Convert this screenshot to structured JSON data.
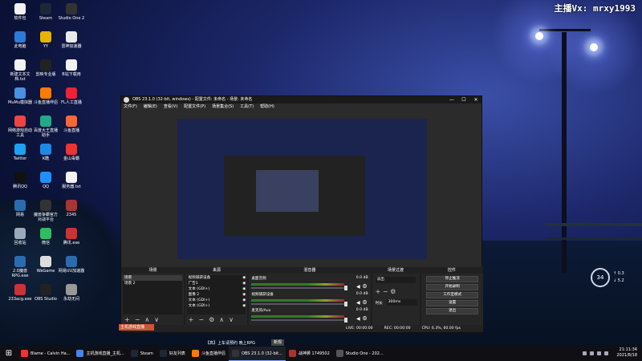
{
  "streamer_watermark": "主播Vx: mrxy1993",
  "desktop_icons": [
    {
      "label": "软件包",
      "color": "#f2f2f2"
    },
    {
      "label": "Steam",
      "color": "#1b2838"
    },
    {
      "label": "Studio One 2",
      "color": "#333"
    },
    {
      "label": "此电脑",
      "color": "#2e7bd6"
    },
    {
      "label": "YY",
      "color": "#e6b400"
    },
    {
      "label": "雷神加速器",
      "color": "#eaeaea"
    },
    {
      "label": "新建文本文档.txt",
      "color": "#f2f2f2"
    },
    {
      "label": "剪映专业版",
      "color": "#222"
    },
    {
      "label": "B站下载用",
      "color": "#f2f2f2"
    },
    {
      "label": "MuMu模拟器",
      "color": "#4a90e2"
    },
    {
      "label": "斗鱼直播伴侣",
      "color": "#ff7a00"
    },
    {
      "label": "FL人工直播",
      "color": "#e23"
    },
    {
      "label": "网络游戏自动工具",
      "color": "#e44"
    },
    {
      "label": "百度大王直播助手",
      "color": "#2a8"
    },
    {
      "label": "斗鱼直播",
      "color": "#f63"
    },
    {
      "label": "Twitter",
      "color": "#1da1f2"
    },
    {
      "label": "K酷",
      "color": "#1e88e5"
    },
    {
      "label": "金山毒霸",
      "color": "#e33"
    },
    {
      "label": "腾讯QQ",
      "color": "#111"
    },
    {
      "label": "QQ",
      "color": "#1e90ff"
    },
    {
      "label": "服务器.txt",
      "color": "#f2f2f2"
    },
    {
      "label": "网易",
      "color": "#2b6cb0"
    },
    {
      "label": "魔兽争霸官方对战平台",
      "color": "#333"
    },
    {
      "label": "2345",
      "color": "#a33"
    },
    {
      "label": "回收站",
      "color": "#9ab"
    },
    {
      "label": "微信",
      "color": "#2dbe60"
    },
    {
      "label": "腾讯.exe",
      "color": "#c33"
    },
    {
      "label": "2.0魔兽RPG.exe",
      "color": "#2b6cb0"
    },
    {
      "label": "WeGame",
      "color": "#ddd"
    },
    {
      "label": "网易UU加速器",
      "color": "#2b6cb0"
    },
    {
      "label": "233acg.exe",
      "color": "#c33"
    },
    {
      "label": "OBS Studio",
      "color": "#222"
    },
    {
      "label": "永劫无间",
      "color": "#999"
    }
  ],
  "obs": {
    "title": "OBS 23.1.0 (32-bit, windows) - 配置文件: 未命名 - 场景: 未命名",
    "menu": [
      "文件(F)",
      "编辑(E)",
      "查看(V)",
      "配置文件(P)",
      "场景集合(S)",
      "工具(T)",
      "帮助(H)"
    ],
    "panel_headers": [
      "场景",
      "来源",
      "混音器",
      "场景过渡",
      "控件"
    ],
    "scenes": [
      "场景",
      "场景 2"
    ],
    "sources": [
      "视频捕获设备",
      "广告1",
      "文本 (GDI+)",
      "图像 2",
      "文本 (GDI+)",
      "文本 (GDI+)"
    ],
    "mixer": [
      {
        "name": "桌面音频",
        "level": "0.0 dB"
      },
      {
        "name": "视频捕获设备",
        "level": "0.0 dB"
      },
      {
        "name": "麦克风/Aux",
        "level": "0.0 dB"
      }
    ],
    "transition": {
      "type": "淡出",
      "duration_label": "时长",
      "duration": "300ms"
    },
    "controls": [
      "停止推流",
      "开始录制",
      "工作室模式",
      "设置",
      "退出"
    ],
    "status": {
      "live": "LIVE: 00:00:00",
      "rec": "REC: 00:00:00",
      "cpu": "CPU: 6.3%, 60.00 fps"
    }
  },
  "overlay": {
    "caption": "主机游戏直播",
    "ticker": "【高】上车请预约  晚上RPG",
    "ticker_btn": "新规"
  },
  "gauge": "34",
  "net": [
    "↑ 0.3",
    "↓ 5.2"
  ],
  "taskbar": [
    {
      "label": "Blame - Calvin Ha...",
      "color": "#e33"
    },
    {
      "label": "主机游戏直播_主机...",
      "color": "#4285f4"
    },
    {
      "label": "Steam",
      "color": "#1b2838"
    },
    {
      "label": "好友列表",
      "color": "#1b2838"
    },
    {
      "label": "斗鱼直播伴侣",
      "color": "#ff7a00"
    },
    {
      "label": "OBS 23.1.0 (32-bit...",
      "color": "#333"
    },
    {
      "label": "战神狮 1749502",
      "color": "#a33"
    },
    {
      "label": "Studio One - 202...",
      "color": "#555"
    }
  ],
  "clock": {
    "time": "21:11:34",
    "date": "2021/8/18"
  }
}
